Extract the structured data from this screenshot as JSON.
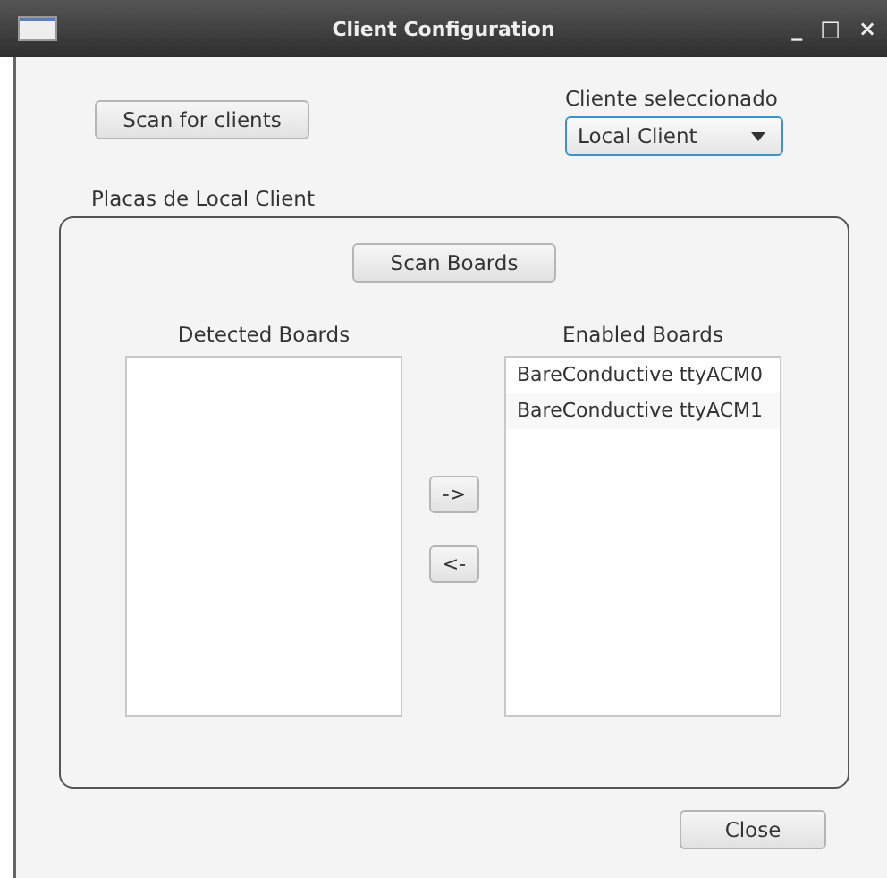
{
  "window": {
    "title": "Client Configuration",
    "controls": [
      "_",
      "□",
      "×"
    ]
  },
  "scan_clients_button": "Scan for clients",
  "client_select": {
    "label": "Cliente seleccionado",
    "value": "Local Client"
  },
  "boards_group": {
    "title": "Placas de Local Client",
    "scan_button": "Scan Boards",
    "detected": {
      "label": "Detected Boards"
    },
    "move_buttons": [
      "->",
      "<-"
    ],
    "enabled": {
      "label": "Enabled Boards",
      "items": [
        "BareConductive ttyACM0",
        "BareConductive ttyACM1"
      ]
    }
  },
  "close_button": "Close"
}
